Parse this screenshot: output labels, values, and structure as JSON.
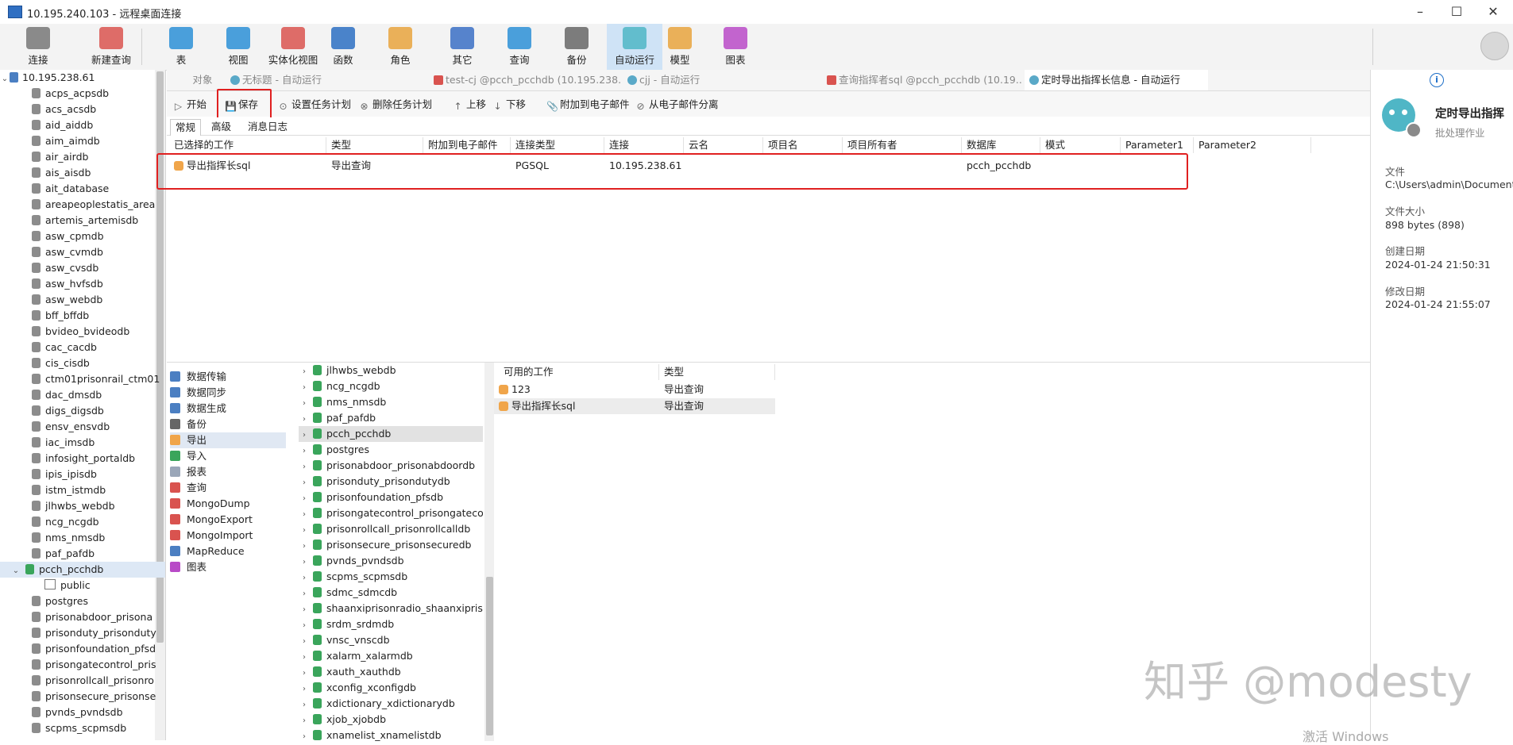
{
  "window": {
    "title": "10.195.240.103 - 远程桌面连接",
    "minimize": "–",
    "maximize": "☐",
    "close": "✕"
  },
  "ribbon": [
    {
      "id": "connect",
      "label": "连接",
      "icon": "plug-icon"
    },
    {
      "id": "newquery",
      "label": "新建查询",
      "icon": "new-query-icon"
    },
    {
      "id": "table",
      "label": "表",
      "icon": "table-icon"
    },
    {
      "id": "view",
      "label": "视图",
      "icon": "view-icon"
    },
    {
      "id": "matview",
      "label": "实体化视图",
      "icon": "materialized-view-icon"
    },
    {
      "id": "function",
      "label": "函数",
      "icon": "function-icon"
    },
    {
      "id": "role",
      "label": "角色",
      "icon": "role-icon"
    },
    {
      "id": "other",
      "label": "其它",
      "icon": "tools-icon"
    },
    {
      "id": "query",
      "label": "查询",
      "icon": "query-icon"
    },
    {
      "id": "backup",
      "label": "备份",
      "icon": "backup-icon"
    },
    {
      "id": "automation",
      "label": "自动运行",
      "icon": "robot-icon"
    },
    {
      "id": "model",
      "label": "模型",
      "icon": "model-icon"
    },
    {
      "id": "chart",
      "label": "图表",
      "icon": "chart-icon"
    }
  ],
  "tree": {
    "root": "10.195.238.61",
    "items": [
      "acps_acpsdb",
      "acs_acsdb",
      "aid_aiddb",
      "aim_aimdb",
      "air_airdb",
      "ais_aisdb",
      "ait_database",
      "areapeoplestatis_area",
      "artemis_artemisdb",
      "asw_cpmdb",
      "asw_cvmdb",
      "asw_cvsdb",
      "asw_hvfsdb",
      "asw_webdb",
      "bff_bffdb",
      "bvideo_bvideodb",
      "cac_cacdb",
      "cis_cisdb",
      "ctm01prisonrail_ctm01",
      "dac_dmsdb",
      "digs_digsdb",
      "ensv_ensvdb",
      "iac_imsdb",
      "infosight_portaldb",
      "ipis_ipisdb",
      "istm_istmdb",
      "jlhwbs_webdb",
      "ncg_ncgdb",
      "nms_nmsdb",
      "paf_pafdb",
      "pcch_pcchdb",
      "public",
      "postgres",
      "prisonabdoor_prisona",
      "prisonduty_prisonduty",
      "prisonfoundation_pfsd",
      "prisongatecontrol_pris",
      "prisonrollcall_prisonro",
      "prisonsecure_prisonse",
      "pvnds_pvndsdb",
      "scpms_scpmsdb"
    ],
    "selected": "pcch_pcchdb"
  },
  "tabs": [
    {
      "label": "对象"
    },
    {
      "label": "无标题 - 自动运行"
    },
    {
      "label": "test-cj @pcch_pcchdb (10.195.238.61..."
    },
    {
      "label": "cjj - 自动运行"
    },
    {
      "label": "查询指挥者sql @pcch_pcchdb (10.19..."
    },
    {
      "label": "定时导出指挥长信息 - 自动运行"
    }
  ],
  "toolbar": [
    {
      "label": "开始",
      "icon": "play-icon"
    },
    {
      "label": "保存",
      "icon": "save-icon"
    },
    {
      "label": "设置任务计划",
      "icon": "schedule-icon"
    },
    {
      "label": "删除任务计划",
      "icon": "delete-schedule-icon"
    },
    {
      "label": "上移",
      "icon": "arrow-up-icon"
    },
    {
      "label": "下移",
      "icon": "arrow-down-icon"
    },
    {
      "label": "附加到电子邮件",
      "icon": "attach-icon"
    },
    {
      "label": "从电子邮件分离",
      "icon": "detach-icon"
    }
  ],
  "subtabs": [
    "常规",
    "高级",
    "消息日志"
  ],
  "jobs": {
    "columns": [
      "已选择的工作",
      "类型",
      "附加到电子邮件",
      "连接类型",
      "连接",
      "云名",
      "项目名",
      "项目所有者",
      "数据库",
      "模式",
      "Parameter1",
      "Parameter2"
    ],
    "row": {
      "work": "导出指挥长sql",
      "type": "导出查询",
      "conntype": "PGSQL",
      "conn": "10.195.238.61",
      "db": "pcch_pcchdb"
    }
  },
  "categories": [
    "数据传输",
    "数据同步",
    "数据生成",
    "备份",
    "导出",
    "导入",
    "报表",
    "查询",
    "MongoDump",
    "MongoExport",
    "MongoImport",
    "MapReduce",
    "图表"
  ],
  "category_selected": "导出",
  "databases": [
    "jlhwbs_webdb",
    "ncg_ncgdb",
    "nms_nmsdb",
    "paf_pafdb",
    "pcch_pcchdb",
    "postgres",
    "prisonabdoor_prisonabdoordb",
    "prisonduty_prisondutydb",
    "prisonfoundation_pfsdb",
    "prisongatecontrol_prisongatecor",
    "prisonrollcall_prisonrollcalldb",
    "prisonsecure_prisonsecuredb",
    "pvnds_pvndsdb",
    "scpms_scpmsdb",
    "sdmc_sdmcdb",
    "shaanxiprisonradio_shaanxipriso",
    "srdm_srdmdb",
    "vnsc_vnscdb",
    "xalarm_xalarmdb",
    "xauth_xauthdb",
    "xconfig_xconfigdb",
    "xdictionary_xdictionarydb",
    "xjob_xjobdb",
    "xnamelist_xnamelistdb"
  ],
  "database_selected": "pcch_pcchdb",
  "available": {
    "columns": [
      "可用的工作",
      "类型"
    ],
    "rows": [
      {
        "work": "123",
        "type": "导出查询"
      },
      {
        "work": "导出指挥长sql",
        "type": "导出查询"
      }
    ]
  },
  "info": {
    "title": "定时导出指挥",
    "subtitle": "批处理作业",
    "file_label": "文件",
    "file_value": "C:\\Users\\admin\\Documents",
    "size_label": "文件大小",
    "size_value": "898 bytes (898)",
    "created_label": "创建日期",
    "created_value": "2024-01-24 21:50:31",
    "modified_label": "修改日期",
    "modified_value": "2024-01-24 21:55:07"
  },
  "watermark": "知乎 @modesty",
  "activate": "激活 Windows",
  "colors": {
    "accent": "#cfe3f6",
    "highlight": "#e02020",
    "db_green": "#3aa55b"
  }
}
